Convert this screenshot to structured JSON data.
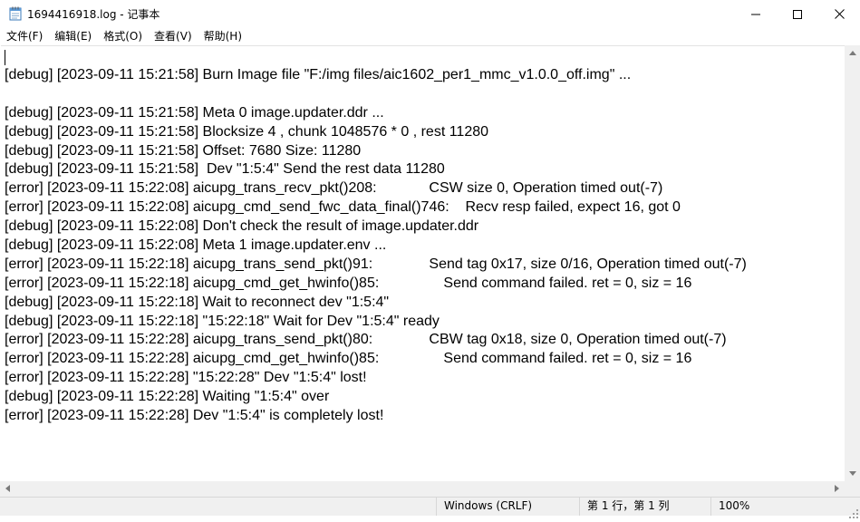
{
  "window": {
    "title": "1694416918.log - 记事本",
    "icon": "notepad-icon",
    "controls": [
      "minimize-icon",
      "maximize-icon",
      "close-icon"
    ]
  },
  "menu": [
    "文件(F)",
    "编辑(E)",
    "格式(O)",
    "查看(V)",
    "帮助(H)"
  ],
  "lines": [
    "[debug] [2023-09-11 15:21:58] Burn Image file \"F:/img files/aic1602_per1_mmc_v1.0.0_off.img\" ...",
    "",
    "[debug] [2023-09-11 15:21:58] Meta 0 image.updater.ddr ...",
    "[debug] [2023-09-11 15:21:58] Blocksize 4 , chunk 1048576 * 0 , rest 11280",
    "[debug] [2023-09-11 15:21:58] Offset: 7680 Size: 11280",
    "[debug] [2023-09-11 15:21:58]  Dev \"1:5:4\" Send the rest data 11280",
    "[error] [2023-09-11 15:22:08] aicupg_trans_recv_pkt()208:             CSW size 0, Operation timed out(-7)",
    "[error] [2023-09-11 15:22:08] aicupg_cmd_send_fwc_data_final()746:    Recv resp failed, expect 16, got 0",
    "[debug] [2023-09-11 15:22:08] Don't check the result of image.updater.ddr",
    "[debug] [2023-09-11 15:22:08] Meta 1 image.updater.env ...",
    "[error] [2023-09-11 15:22:18] aicupg_trans_send_pkt()91:              Send tag 0x17, size 0/16, Operation timed out(-7)",
    "[error] [2023-09-11 15:22:18] aicupg_cmd_get_hwinfo()85:                Send command failed. ret = 0, siz = 16",
    "[debug] [2023-09-11 15:22:18] Wait to reconnect dev \"1:5:4\"",
    "[debug] [2023-09-11 15:22:18] \"15:22:18\" Wait for Dev \"1:5:4\" ready",
    "[error] [2023-09-11 15:22:28] aicupg_trans_send_pkt()80:              CBW tag 0x18, size 0, Operation timed out(-7)",
    "[error] [2023-09-11 15:22:28] aicupg_cmd_get_hwinfo()85:                Send command failed. ret = 0, siz = 16",
    "[error] [2023-09-11 15:22:28] \"15:22:28\" Dev \"1:5:4\" lost!",
    "[debug] [2023-09-11 15:22:28] Waiting \"1:5:4\" over",
    "[error] [2023-09-11 15:22:28] Dev \"1:5:4\" is completely lost!"
  ],
  "status": {
    "encoding": "Windows (CRLF)",
    "position": "第 1 行，第 1 列",
    "zoom": "100%"
  }
}
